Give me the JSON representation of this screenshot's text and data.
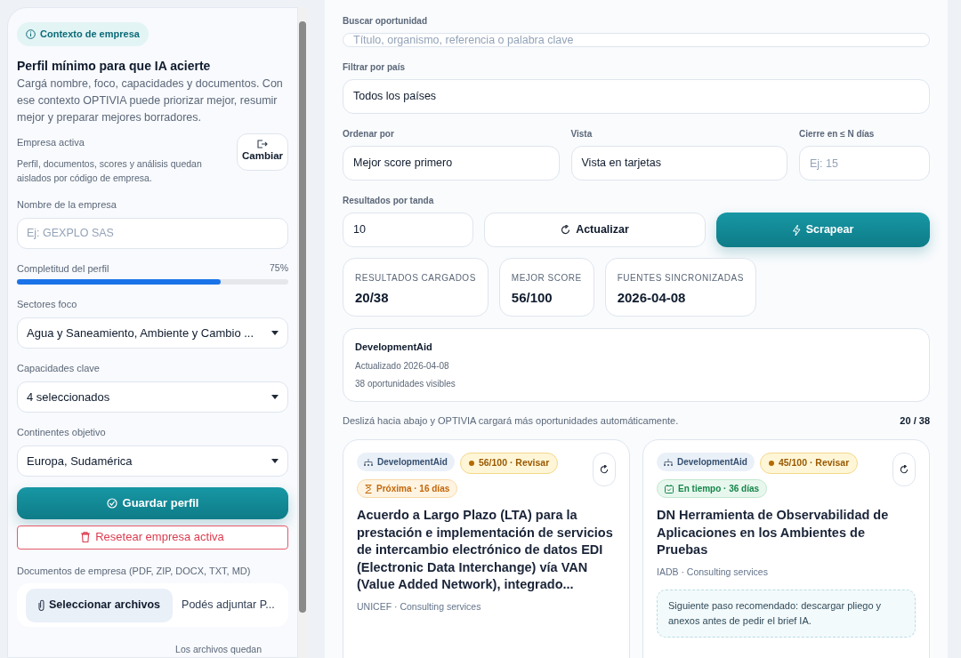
{
  "sidebar": {
    "badge": "Contexto de empresa",
    "title": "Perfil mínimo para que IA acierte",
    "description": "Cargá nombre, foco, capacidades y documentos. Con ese contexto OPTIVIA puede priorizar mejor, resumir mejor y preparar mejores borradores.",
    "active_company": {
      "label": "Empresa activa",
      "note": "Perfil, documentos, scores y análisis quedan aislados por código de empresa.",
      "button": "Cambiar"
    },
    "company_name": {
      "label": "Nombre de la empresa",
      "placeholder": "Ej: GEXPLO SAS"
    },
    "completeness": {
      "label": "Completitud del perfil",
      "reading": "75%",
      "level": 0.75
    },
    "selects": [
      {
        "label": "Sectores foco",
        "value": "Agua y Saneamiento, Ambiente y Cambio ..."
      },
      {
        "label": "Capacidades clave",
        "value": "4 seleccionados"
      },
      {
        "label": "Continentes objetivo",
        "value": "Europa, Sudamérica"
      }
    ],
    "save_button": "Guardar perfil",
    "reset_button": "Resetear empresa activa",
    "documents": {
      "label": "Documentos de empresa (PDF, ZIP, DOCX, TXT, MD)",
      "button": "Seleccionar archivos",
      "hint": "Podés adjuntar P...",
      "footer": "Los archivos quedan"
    }
  },
  "filters": {
    "search": {
      "label": "Buscar oportunidad",
      "placeholder": "Título, organismo, referencia o palabra clave"
    },
    "country": {
      "label": "Filtrar por país",
      "value": "Todos los países"
    },
    "sort": {
      "label": "Ordenar por",
      "value": "Mejor score primero"
    },
    "view": {
      "label": "Vista",
      "value": "Vista en tarjetas"
    },
    "closing": {
      "label": "Cierre en ≤ N días",
      "placeholder": "Ej: 15"
    },
    "batch": {
      "label": "Resultados por tanda",
      "value": "10"
    },
    "refresh_button": "Actualizar",
    "scrape_button": "Scrapear"
  },
  "stats": [
    {
      "label": "RESULTADOS CARGADOS",
      "value": "20/38"
    },
    {
      "label": "MEJOR SCORE",
      "value": "56/100"
    },
    {
      "label": "FUENTES SINCRONIZADAS",
      "value": "2026-04-08"
    }
  ],
  "source": {
    "name": "DevelopmentAid",
    "updated": "Actualizado 2026-04-08",
    "visible": "38 oportunidades visibles"
  },
  "scroll_hint": "Deslizá hacia abajo y OPTIVIA cargará más oportunidades automáticamente.",
  "count": "20 / 38",
  "cards": [
    {
      "source": "DevelopmentAid",
      "score": "56/100 · Revisar",
      "deadline": {
        "kind": "soon",
        "text": "Próxima · 16 días"
      },
      "title": "Acuerdo a Largo Plazo (LTA) para la prestación e implementación de servicios de intercambio electrónico de datos EDI (Electronic Data Interchange) vía VAN (Value Added Network), integrado...",
      "meta": "UNICEF · Consulting services"
    },
    {
      "source": "DevelopmentAid",
      "score": "45/100 · Revisar",
      "deadline": {
        "kind": "ontime",
        "text": "En tiempo · 36 días"
      },
      "title": "DN Herramienta de Observabilidad de Aplicaciones en los Ambientes de Pruebas",
      "meta": "IADB · Consulting services",
      "next_step": "Siguiente paso recomendado: descargar pliego y anexos antes de pedir el brief IA."
    }
  ]
}
